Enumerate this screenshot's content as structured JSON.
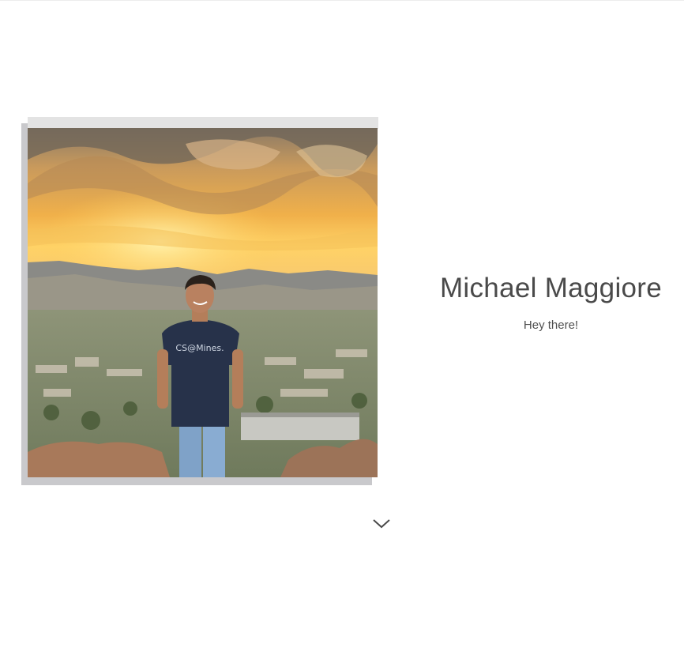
{
  "profile": {
    "name": "Michael Maggiore",
    "tagline": "Hey there!",
    "shirt_text": "CS@Mines.",
    "photo_icon": "profile-photo"
  },
  "navigation": {
    "scroll_icon": "chevron-down-icon"
  },
  "colors": {
    "background": "#ffffff",
    "text": "#4a4a4a",
    "frame_backing": "#c9c9cc",
    "frame_top": "#e3e3e3"
  }
}
